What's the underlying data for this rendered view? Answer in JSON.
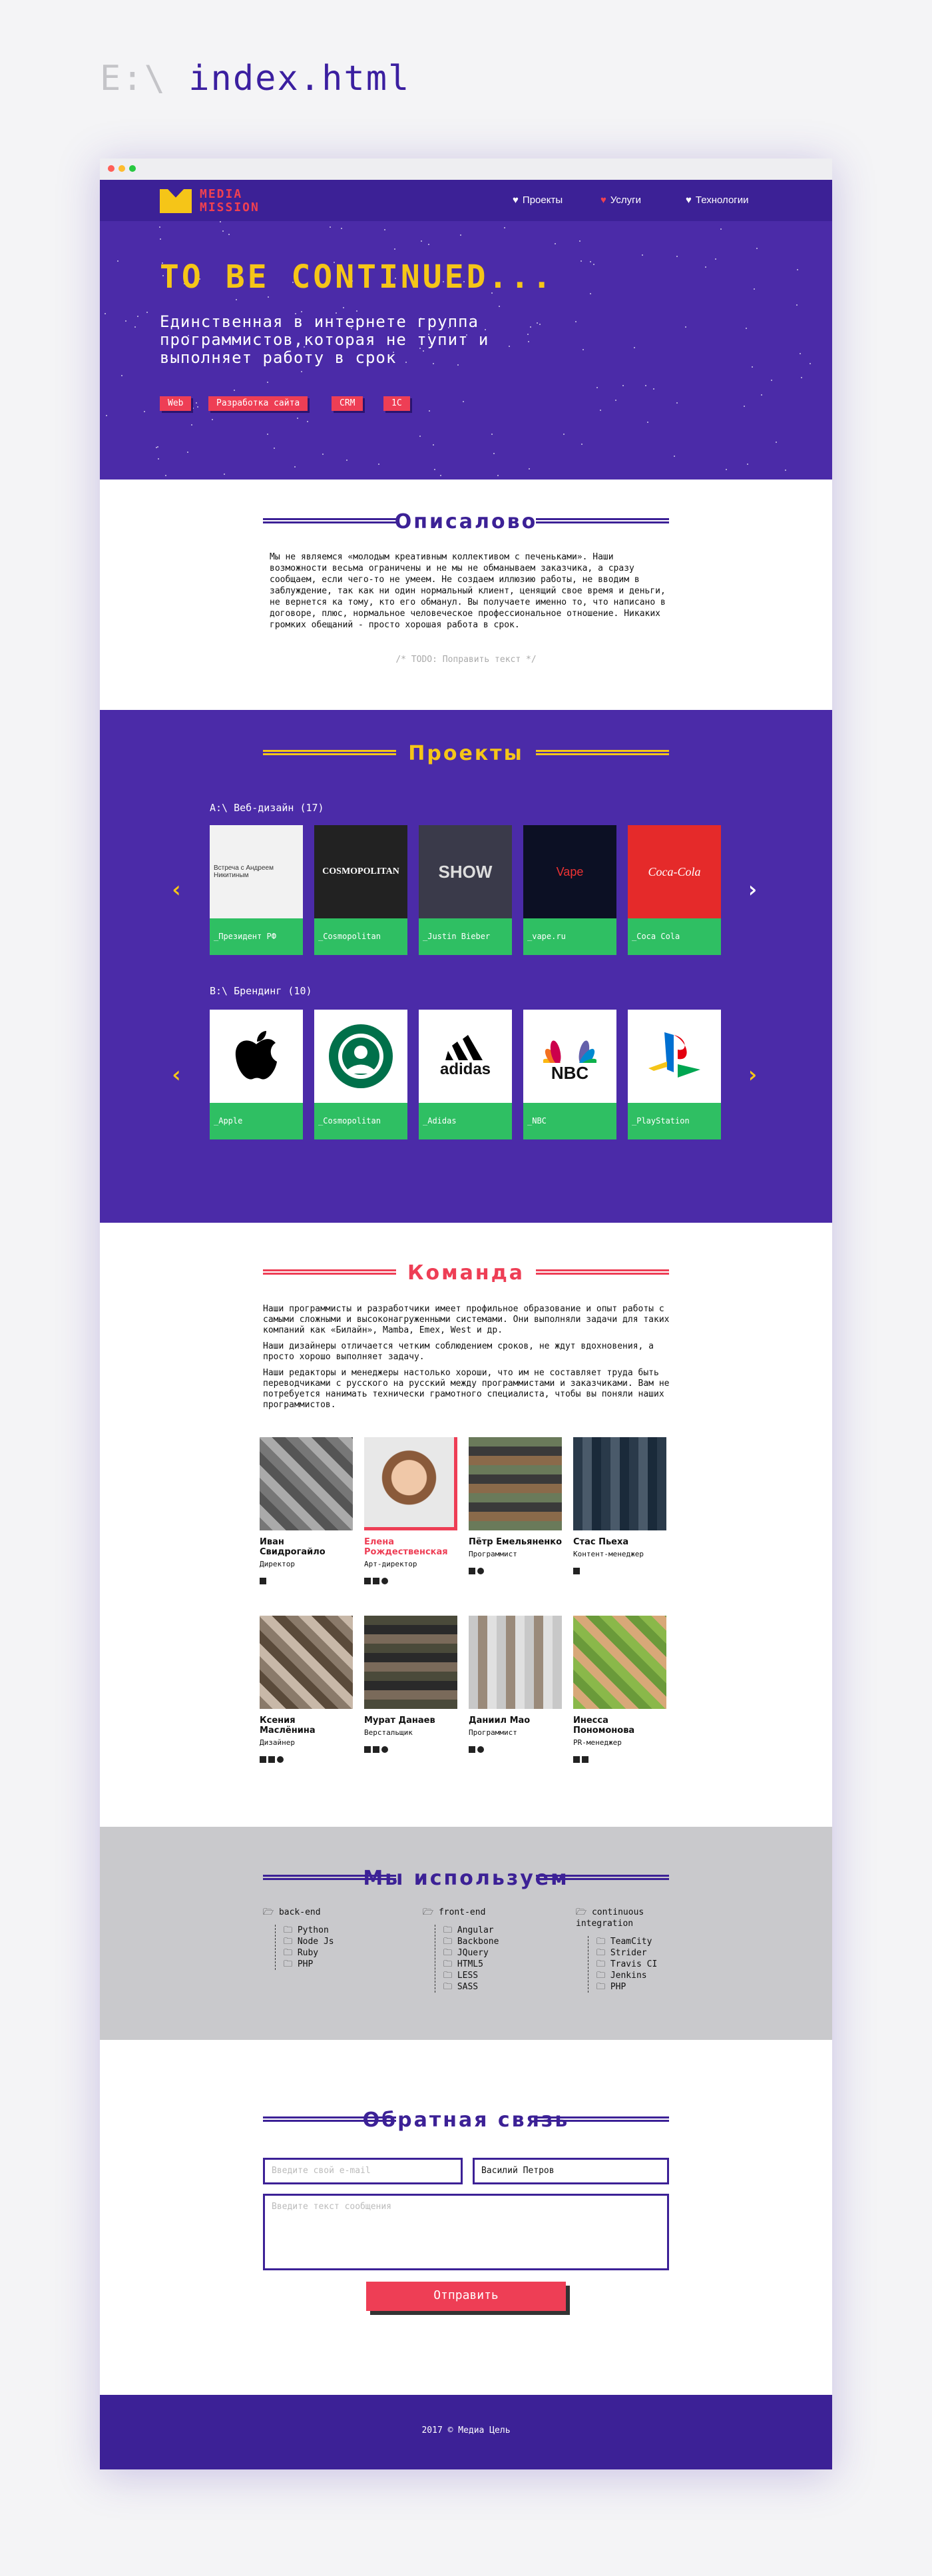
{
  "file": {
    "drive": "E:\\",
    "name": "index.html"
  },
  "nav": {
    "logo_line1": "MEDIA",
    "logo_line2": "MISSION",
    "items": [
      "Проекты",
      "Услуги",
      "Технологии"
    ]
  },
  "hero": {
    "title": "TO BE CONTINUED...",
    "subtitle": "Единственная в интернете группа программистов,которая не тупит и выполняет работу в срок",
    "tags": [
      "Web",
      "Разработка сайта",
      "CRM",
      "1C"
    ]
  },
  "about": {
    "title": "Описалово",
    "text": "Мы не являемся «молодым креативным коллективом с печеньками». Наши возможности весьма ограничены и не мы не обманываем заказчика, а сразу сообщаем, если чего-то не умеем. Не создаем иллюзию работы, не вводим в заблуждение, так как ни один нормальный клиент, ценящий свое время и деньги, не вернется ка тому, кто его обманул. Вы получаете именно то, что написано в договоре, плюс, нормальное человеческое профессиональное отношение. Никаких громких обещаний - просто хорошая работа в срок.",
    "todo": "/* TODO: Поправить текст */"
  },
  "projects": {
    "title": "Проекты",
    "web_label": "A:\\ Веб-дизайн (17)",
    "brand_label": "B:\\ Брендинг (10)",
    "web": [
      "_Президент РФ",
      "_Cosmopolitan",
      "_Justin Bieber",
      "_vape.ru",
      "_Coca Cola"
    ],
    "brand": [
      "_Apple",
      "_Cosmopolitan",
      "_Adidas",
      "_NBC",
      "_PlayStation"
    ],
    "web_thumb_texts": [
      "Встреча с Андреем Никитиным",
      "COSMOPOLITAN",
      "SHOW",
      "Vape",
      "Coca-Cola"
    ],
    "brand_thumb_texts": [
      "",
      "",
      "adidas",
      "NBC",
      ""
    ]
  },
  "team": {
    "title": "Команда",
    "p1": "Наши программисты и разработчики имеет профильное образование и опыт работы с самыми сложными и высоконагруженными системами. Они выполняли задачи для таких компаний как «Билайн», Mamba, Emex, West и др.",
    "p2": "Наши дизайнеры отличается четким соблюдением сроков, не ждут вдохновения, а просто хорошо выполняет задачу.",
    "p3": "Наши редакторы и менеджеры настолько хороши, что им не составляет труда быть переводчиками с русского на русский между программистами и заказчиками. Вам не потребуется нанимать технически грамотного специалиста, чтобы вы поняли наших программистов.",
    "members": [
      {
        "name": "Иван Свидрогайло",
        "role": "Директор"
      },
      {
        "name": "Елена Рождественская",
        "role": "Арт-директор"
      },
      {
        "name": "Пётр Емельяненко",
        "role": "Программист"
      },
      {
        "name": "Стас Пьеха",
        "role": "Контент-менеджер"
      },
      {
        "name": "Ксения Маслёнина",
        "role": "Дизайнер"
      },
      {
        "name": "Мурат Данаев",
        "role": "Верстальщик"
      },
      {
        "name": "Даниил Мао",
        "role": "Программист"
      },
      {
        "name": "Инесса Пономонова",
        "role": "PR-менеджер"
      }
    ]
  },
  "tech": {
    "title": "Мы используем",
    "cols": [
      {
        "head": "back-end",
        "items": [
          "Python",
          "Node Js",
          "Ruby",
          "PHP"
        ]
      },
      {
        "head": "front-end",
        "items": [
          "Angular",
          "Backbone",
          "JQuery",
          "HTML5",
          "LESS",
          "SASS"
        ]
      },
      {
        "head": "continuous integration",
        "items": [
          "TeamCity",
          "Strider",
          "Travis CI",
          "Jenkins",
          "PHP"
        ]
      }
    ]
  },
  "contact": {
    "title": "Обратная связь",
    "email_placeholder": "Введите свой e-mail",
    "name_value": "Василий Петров",
    "message_placeholder": "Введите текст сообщения",
    "send": "Отправить"
  },
  "footer": {
    "text": "2017 © Медиа Цель"
  },
  "colors": {
    "purple": "#4b2ba8",
    "yellow": "#f5c518",
    "red": "#ee3e55",
    "green": "#2fbf63"
  }
}
